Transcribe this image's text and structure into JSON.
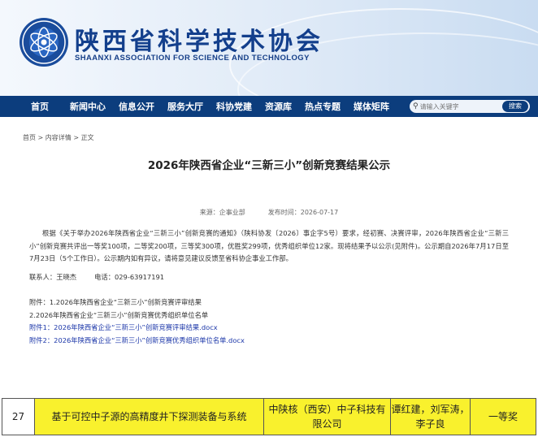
{
  "header": {
    "title": "陕西省科学技术协会",
    "subtitle": "SHAANXI ASSOCIATION FOR SCIENCE AND TECHNOLOGY",
    "logo_icon": "shaanxi-cast-emblem"
  },
  "nav": {
    "items": [
      {
        "label": "首页"
      },
      {
        "label": "新闻中心"
      },
      {
        "label": "信息公开"
      },
      {
        "label": "服务大厅"
      },
      {
        "label": "科协党建"
      },
      {
        "label": "资源库"
      },
      {
        "label": "热点专题"
      },
      {
        "label": "媒体矩阵"
      }
    ],
    "search": {
      "placeholder": "请输入关键字",
      "button_label": "搜索"
    }
  },
  "breadcrumb": {
    "items": [
      "首页",
      "内容详情",
      "正文"
    ],
    "separator": ">"
  },
  "article": {
    "title": "2026年陕西省企业“三新三小”创新竞赛结果公示",
    "source": "来源：企事业部",
    "date": "发布时间：2026-07-17",
    "body": "根据《关于举办2026年陕西省企业“三新三小”创新竞赛的通知》（陕科协发〔2026〕事企字5号）要求，经初赛、决赛评审，2026年陕西省企业“三新三小”创新竞赛共评出一等奖100项，二等奖200项，三等奖300项，优胜奖299项，优秀组织单位12家。现将结果予以公示(见附件)。公示期自2026年7月17日至7月23日（5个工作日）。公示期内如有异议，请将意见建议反馈至省科协企事业工作部。",
    "contact_person": "联系人：王晓杰",
    "contact_phone": "电话：029-63917191",
    "attachments": [
      {
        "text": "附件：1.2026年陕西省企业“三新三小”创新竞赛评审结果",
        "link": false
      },
      {
        "text": "2.2026年陕西省企业“三新三小”创新竞赛优秀组织单位名单",
        "link": false
      },
      {
        "text": "附件1：2026年陕西省企业“三新三小”创新竞赛评审结果.docx",
        "link": true
      },
      {
        "text": "附件2：2026年陕西省企业“三新三小”创新竞赛优秀组织单位名单.docx",
        "link": true
      }
    ]
  },
  "result_row": {
    "number": "27",
    "project": "基于可控中子源的高精度井下探测装备与系统",
    "unit": "中陕核（西安）中子科技有限公司",
    "people": "谭红建，刘军涛，李子良",
    "award": "一等奖",
    "highlight_color": "#f9f12d"
  },
  "colors": {
    "nav_bg": "#0c3d7d",
    "title_blue": "#133f8c",
    "link_blue": "#1a35a8"
  }
}
